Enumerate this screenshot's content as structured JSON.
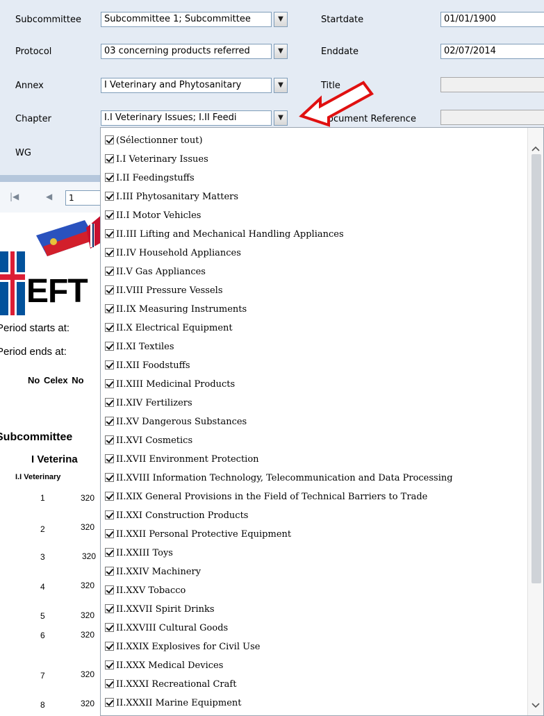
{
  "params": {
    "subcommittee": {
      "label": "Subcommittee",
      "value": "Subcommittee 1; Subcommittee"
    },
    "protocol": {
      "label": "Protocol",
      "value": "03 concerning products referred"
    },
    "annex": {
      "label": "Annex",
      "value": "I Veterinary and Phytosanitary"
    },
    "chapter": {
      "label": "Chapter",
      "value": "I.I Veterinary Issues; I.II Feedi"
    },
    "wg": {
      "label": "WG"
    },
    "startdate": {
      "label": "Startdate",
      "value": "01/01/1900"
    },
    "enddate": {
      "label": "Enddate",
      "value": "02/07/2014"
    },
    "title": {
      "label": "Title",
      "value": ""
    },
    "doc_ref": {
      "label": "Document Reference",
      "value": ""
    },
    "dropdown_arrow": "▼"
  },
  "toolbar": {
    "first_page_icon": "|◀",
    "prev_page_icon": "◀",
    "page_number": "1"
  },
  "report": {
    "logo_text": "EFT",
    "period_starts": "Period starts at:",
    "period_ends": "Period ends at:",
    "columns": "No  Celex No",
    "subcommittee_heading": "Subcommittee",
    "annex_heading": "I Veterina",
    "chapter_heading": "I.I Veterinary",
    "rows": [
      {
        "no": "1",
        "celex": "320"
      },
      {
        "no": "2",
        "celex": "320"
      },
      {
        "no": "3",
        "celex": "320"
      },
      {
        "no": "4",
        "celex": "320"
      },
      {
        "no": "5",
        "celex": "320"
      },
      {
        "no": "6",
        "celex": "320"
      },
      {
        "no": "7",
        "celex": "320"
      },
      {
        "no": "8",
        "celex": "320"
      }
    ]
  },
  "dropdown": {
    "items": [
      "(Sélectionner tout)",
      "I.I Veterinary Issues",
      "I.II Feedingstuffs",
      "I.III Phytosanitary Matters",
      "II.I Motor Vehicles",
      "II.III Lifting and Mechanical Handling Appliances",
      "II.IV Household Appliances",
      "II.V Gas Appliances",
      "II.VIII Pressure Vessels",
      "II.IX Measuring Instruments",
      "II.X Electrical Equipment",
      "II.XI Textiles",
      "II.XII Foodstuffs",
      "II.XIII Medicinal Products",
      "II.XIV Fertilizers",
      "II.XV Dangerous Substances",
      "II.XVI Cosmetics",
      "II.XVII Environment Protection",
      "II.XVIII Information Technology, Telecommunication and Data Processing",
      "II.XIX General Provisions in the Field of Technical Barriers to Trade",
      "II.XXI Construction Products",
      "II.XXII Personal Protective Equipment",
      "II.XXIII Toys",
      "II.XXIV Machinery",
      "II.XXV Tobacco",
      "II.XXVII Spirit Drinks",
      "II.XXVIII Cultural Goods",
      "II.XXIX Explosives for Civil Use",
      "II.XXX Medical Devices",
      "II.XXXI Recreational Craft",
      "II.XXXII Marine Equipment"
    ]
  },
  "colors": {
    "panel_bg": "#e4ebf4",
    "annotation_arrow": "#e01010",
    "border": "#7f9db9"
  }
}
